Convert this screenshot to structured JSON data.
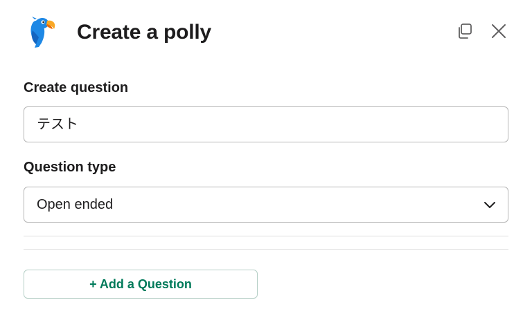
{
  "modal": {
    "title": "Create a polly",
    "logo": "polly-parrot-logo",
    "icons": {
      "popout": "popout-icon",
      "close": "close-icon"
    }
  },
  "form": {
    "question_label": "Create question",
    "question_value": "テスト",
    "type_label": "Question type",
    "type_selected": "Open ended",
    "add_question_label": "+ Add a Question"
  },
  "colors": {
    "accent_green": "#007a5a",
    "border": "#b5b5b5",
    "text": "#1d1c1d"
  }
}
